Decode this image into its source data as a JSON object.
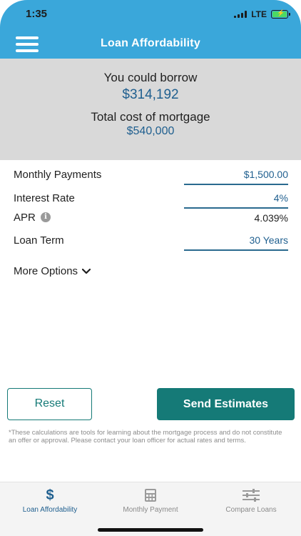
{
  "status_bar": {
    "time": "1:35",
    "network": "LTE"
  },
  "nav": {
    "title": "Loan Affordability",
    "menu_icon": "hamburger-menu-icon"
  },
  "summary": {
    "borrow_label": "You could borrow",
    "borrow_value": "$314,192",
    "total_label": "Total cost of mortgage",
    "total_value": "$540,000"
  },
  "form": {
    "monthly_payments": {
      "label": "Monthly Payments",
      "value": "$1,500.00"
    },
    "interest_rate": {
      "label": "Interest Rate",
      "value": "4%"
    },
    "apr": {
      "label": "APR",
      "value": "4.039%",
      "icon": "info-icon"
    },
    "loan_term": {
      "label": "Loan Term",
      "value": "30 Years"
    },
    "more_options": "More Options"
  },
  "buttons": {
    "reset": "Reset",
    "send": "Send Estimates"
  },
  "disclaimer": "*These calculations are tools for learning about the mortgage process and do not constitute an offer or approval.  Please contact your loan officer for actual rates and terms.",
  "tabs": [
    {
      "label": "Loan Affordability",
      "icon": "dollar-icon",
      "active": true
    },
    {
      "label": "Monthly Payment",
      "icon": "calculator-icon",
      "active": false
    },
    {
      "label": "Compare Loans",
      "icon": "sliders-icon",
      "active": false
    }
  ],
  "colors": {
    "header": "#3aa7da",
    "summary_bg": "#d9d9d9",
    "value_blue": "#1f5f8f",
    "accent_teal": "#157a77"
  }
}
